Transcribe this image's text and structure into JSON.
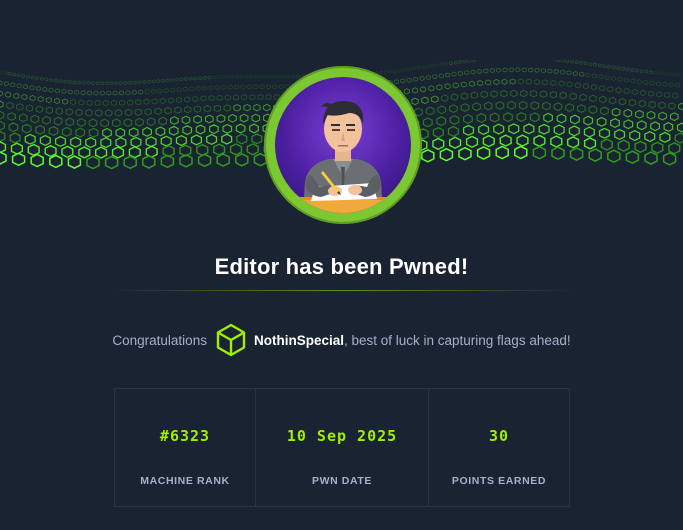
{
  "title": "Editor has been Pwned!",
  "congrats": {
    "prefix": "Congratulations",
    "user": "NothinSpecial",
    "suffix": ", best of luck in capturing flags ahead!"
  },
  "stats": [
    {
      "value": "#6323",
      "label": "MACHINE RANK"
    },
    {
      "value": "10 Sep 2025",
      "label": "PWN DATE"
    },
    {
      "value": "30",
      "label": "POINTS EARNED"
    }
  ],
  "colors": {
    "background": "#1a2332",
    "accent_green": "#9fef00",
    "muted_text": "#a4b1cd",
    "avatar_ring": "#7cc832"
  },
  "icons": {
    "banner": "green-cube-grid-banner",
    "avatar": "machine-avatar-man-writing",
    "user_badge": "cube-icon"
  }
}
